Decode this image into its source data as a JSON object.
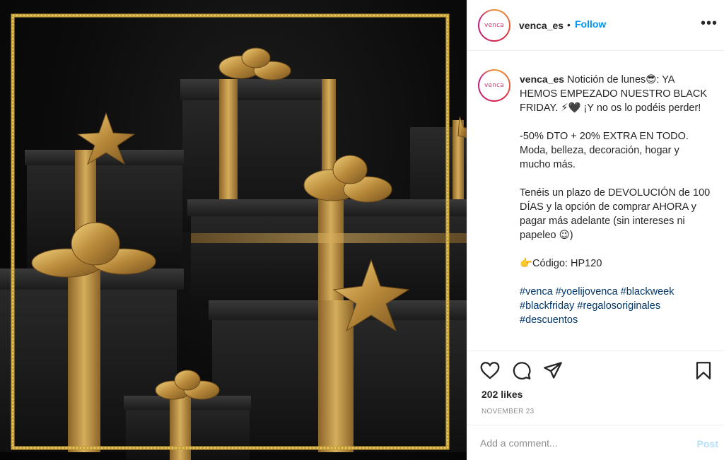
{
  "post": {
    "username": "venca_es",
    "avatar_text": "venca",
    "separator": "•",
    "follow_label": "Follow",
    "more_label": "•••",
    "caption": "Notición de lunes😎: YA HEMOS EMPEZADO NUESTRO BLACK FRIDAY. ⚡🖤 ¡Y no os lo podéis perder!\n\n-50% DTO + 20% EXTRA EN TODO. Moda, belleza, decoración, hogar y mucho más.\n\nTenéis un plazo de DEVOLUCIÓN de 100 DÍAS y la opción de comprar AHORA y pagar más adelante (sin intereses ni papeleo 😉)\n\n👉Código: HP120\n\n",
    "hashtags": "#venca #yoelijovenca #blackweek #blackfriday #regalosoriginales #descuentos",
    "likes": "202 likes",
    "date": "NOVEMBER 23"
  },
  "comment": {
    "placeholder": "Add a comment...",
    "post_label": "Post"
  },
  "image": {
    "description_icon": "gift-boxes-image",
    "frame_color": "#c9a23a",
    "ribbon_color": "#b8893a"
  },
  "colors": {
    "accent": "#0095f6",
    "hashtag": "#00376b",
    "muted": "#8e8e8e"
  }
}
